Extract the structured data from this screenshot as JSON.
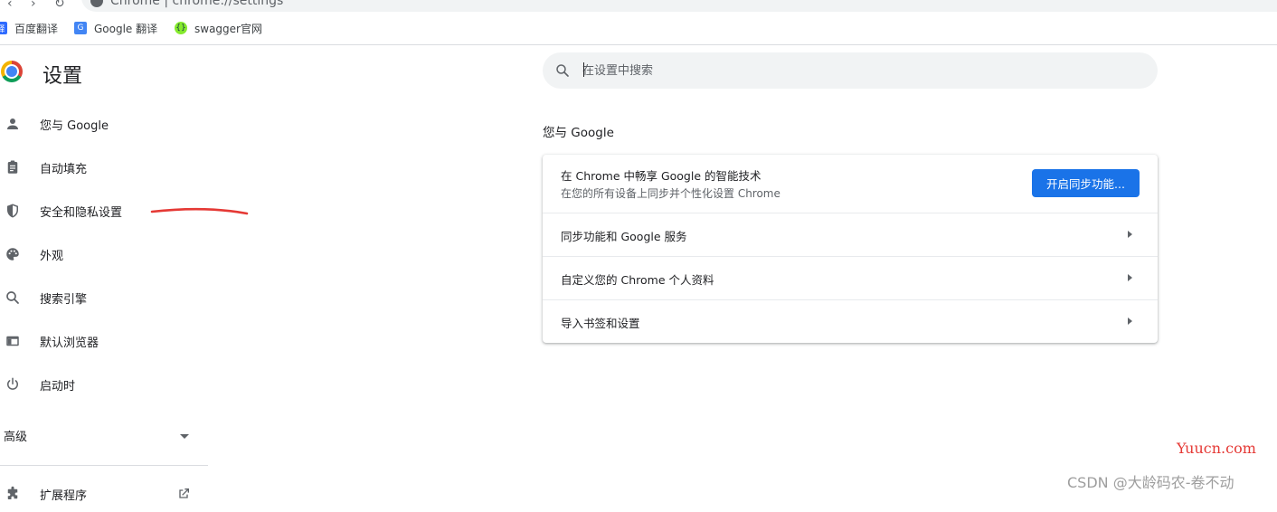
{
  "browser": {
    "url": "Chrome  |  chrome://settings",
    "bookmarks": [
      {
        "label": "百度翻译",
        "fav_color": "#2f6bff",
        "fav_glyph": "译"
      },
      {
        "label": "Google 翻译",
        "fav_color": "#4285f4",
        "fav_glyph": "G"
      },
      {
        "label": "swagger官网",
        "fav_color": "#85ea2d",
        "fav_glyph": "{}"
      }
    ]
  },
  "sidebar": {
    "title": "设置",
    "items": [
      {
        "label": "您与 Google",
        "icon": "person-icon"
      },
      {
        "label": "自动填充",
        "icon": "clipboard-icon"
      },
      {
        "label": "安全和隐私设置",
        "icon": "shield-icon"
      },
      {
        "label": "外观",
        "icon": "palette-icon"
      },
      {
        "label": "搜索引擎",
        "icon": "search-icon"
      },
      {
        "label": "默认浏览器",
        "icon": "browser-icon"
      },
      {
        "label": "启动时",
        "icon": "power-icon"
      }
    ],
    "advanced_label": "高级",
    "extensions_label": "扩展程序"
  },
  "search": {
    "placeholder": "在设置中搜索"
  },
  "section": {
    "title": "您与 Google"
  },
  "sync_card": {
    "title": "在 Chrome 中畅享 Google 的智能技术",
    "subtitle": "在您的所有设备上同步并个性化设置 Chrome",
    "button_label": "开启同步功能...",
    "rows": [
      {
        "label": "同步功能和 Google 服务"
      },
      {
        "label": "自定义您的 Chrome 个人资料"
      },
      {
        "label": "导入书签和设置"
      }
    ]
  },
  "colors": {
    "accent": "#1a73e8",
    "annotation": "#e53935"
  },
  "watermarks": {
    "site": "Yuucn.com",
    "author": "CSDN @大龄码农-卷不动"
  }
}
